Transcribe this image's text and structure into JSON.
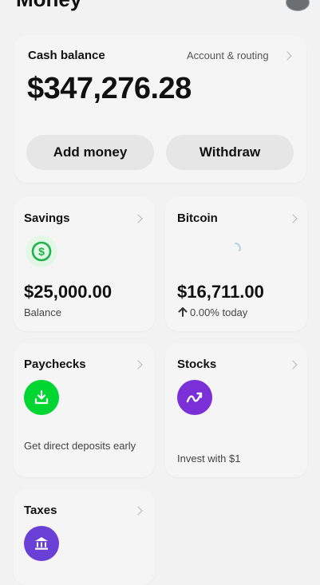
{
  "header": {
    "title": "Money"
  },
  "cash": {
    "label": "Cash balance",
    "account_link": "Account & routing",
    "amount": "$347,276.28",
    "add_money": "Add money",
    "withdraw": "Withdraw"
  },
  "savings": {
    "title": "Savings",
    "amount": "$25,000.00",
    "sub": "Balance"
  },
  "bitcoin": {
    "title": "Bitcoin",
    "amount": "$16,711.00",
    "change": "0.00% today"
  },
  "paychecks": {
    "title": "Paychecks",
    "sub": "Get direct deposits early"
  },
  "stocks": {
    "title": "Stocks",
    "sub": "Invest with $1"
  },
  "taxes": {
    "title": "Taxes"
  },
  "colors": {
    "green": "#00d632",
    "purple": "#7b2fd6",
    "taxes_purple": "#6a3fd6"
  },
  "icons": {
    "savings": "dollar-circle-icon",
    "bitcoin": "loading-spinner-icon",
    "paychecks": "download-tray-icon",
    "stocks": "trend-up-icon",
    "taxes": "bank-icon",
    "bitcoin_change": "arrow-up-icon"
  }
}
